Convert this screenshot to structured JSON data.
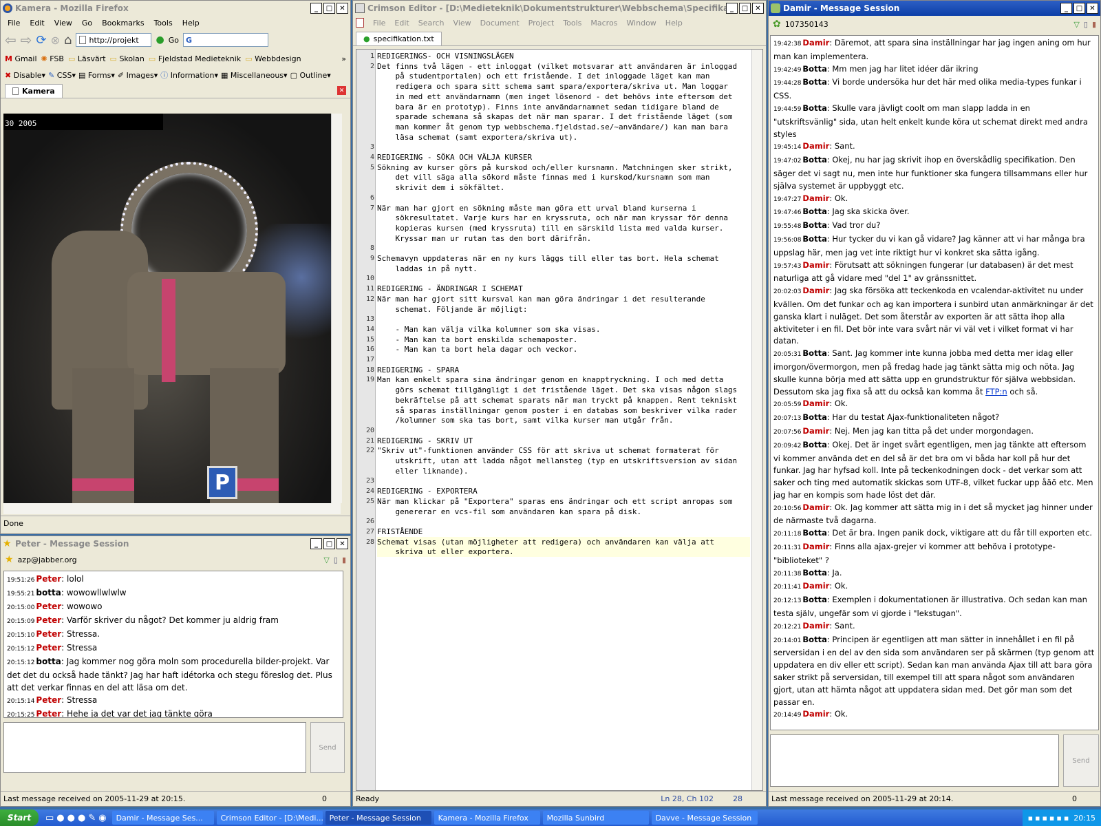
{
  "firefox": {
    "title": "Kamera - Mozilla Firefox",
    "menu": [
      "File",
      "Edit",
      "View",
      "Go",
      "Bookmarks",
      "Tools",
      "Help"
    ],
    "url": "http://projekt",
    "go_label": "Go",
    "bookmarks": [
      "Gmail",
      "FSB",
      "Läsvärt",
      "Skolan",
      "Fjeldstad Medieteknik",
      "Webbdesign"
    ],
    "webdev": [
      "Disable",
      "CSS",
      "Forms",
      "Images",
      "Information",
      "Miscellaneous",
      "Outline"
    ],
    "tab_label": "Kamera",
    "cam_timestamp": "30 2005",
    "status": "Done"
  },
  "peter": {
    "title": "Peter - Message Session",
    "contact": "azp@jabber.org",
    "messages": [
      {
        "ts": "19:51:26",
        "who": "Peter",
        "text": "lolol"
      },
      {
        "ts": "19:55:21",
        "who": "botta",
        "text": "wowowllwlwlw"
      },
      {
        "ts": "20:15:00",
        "who": "Peter",
        "text": "wowowo"
      },
      {
        "ts": "20:15:09",
        "who": "Peter",
        "text": "Varför skriver du något? Det kommer ju aldrig fram"
      },
      {
        "ts": "20:15:10",
        "who": "Peter",
        "text": "Stressa."
      },
      {
        "ts": "20:15:12",
        "who": "Peter",
        "text": "Stressa"
      },
      {
        "ts": "20:15:12",
        "who": "botta",
        "text": "Jag kommer nog göra moln som procedurella bilder-projekt. Var det det du också hade tänkt? Jag har haft idétorka och stegu föreslog det. Plus att det verkar finnas en del att läsa om det."
      },
      {
        "ts": "20:15:14",
        "who": "Peter",
        "text": "Stressa"
      },
      {
        "ts": "20:15:25",
        "who": "Peter",
        "text": "Hehe ja det var det jag tänkte göra"
      }
    ],
    "send_label": "Send",
    "status": "Last message received on 2005-11-29 at 20:15.",
    "count": "0"
  },
  "crimson": {
    "title": "Crimson Editor - [D:\\Medieteknik\\Dokumentstrukturer\\Webbschema\\Specifikation\\specifika...",
    "menu": [
      "File",
      "Edit",
      "Search",
      "View",
      "Document",
      "Project",
      "Tools",
      "Macros",
      "Window",
      "Help"
    ],
    "tab": "specifikation.txt",
    "rows": [
      {
        "n": "1",
        "t": "REDIGERINGS- OCH VISNINGSLÄGEN"
      },
      {
        "n": "2",
        "t": "Det finns två lägen - ett inloggat (vilket motsvarar att användaren är inloggad"
      },
      {
        "n": "",
        "t": "    på studentportalen) och ett fristående. I det inloggade läget kan man"
      },
      {
        "n": "",
        "t": "    redigera och spara sitt schema samt spara/exportera/skriva ut. Man loggar"
      },
      {
        "n": "",
        "t": "    in med ett användarnamn (men inget lösenord - det behövs inte eftersom det"
      },
      {
        "n": "",
        "t": "    bara är en prototyp). Finns inte användarnamnet sedan tidigare bland de"
      },
      {
        "n": "",
        "t": "    sparade schemana så skapas det när man sparar. I det fristående läget (som"
      },
      {
        "n": "",
        "t": "    man kommer åt genom typ webbschema.fjeldstad.se/~användare/) kan man bara"
      },
      {
        "n": "",
        "t": "    läsa schemat (samt exportera/skriva ut)."
      },
      {
        "n": "3",
        "t": ""
      },
      {
        "n": "4",
        "t": "REDIGERING - SÖKA OCH VÄLJA KURSER"
      },
      {
        "n": "5",
        "t": "Sökning av kurser görs på kurskod och/eller kursnamn. Matchningen sker strikt,"
      },
      {
        "n": "",
        "t": "    det vill säga alla sökord måste finnas med i kurskod/kursnamn som man"
      },
      {
        "n": "",
        "t": "    skrivit dem i sökfältet."
      },
      {
        "n": "6",
        "t": ""
      },
      {
        "n": "7",
        "t": "När man har gjort en sökning måste man göra ett urval bland kurserna i"
      },
      {
        "n": "",
        "t": "    sökresultatet. Varje kurs har en kryssruta, och när man kryssar för denna"
      },
      {
        "n": "",
        "t": "    kopieras kursen (med kryssruta) till en särskild lista med valda kurser."
      },
      {
        "n": "",
        "t": "    Kryssar man ur rutan tas den bort därifrån."
      },
      {
        "n": "8",
        "t": ""
      },
      {
        "n": "9",
        "t": "Schemavyn uppdateras när en ny kurs läggs till eller tas bort. Hela schemat"
      },
      {
        "n": "",
        "t": "    laddas in på nytt."
      },
      {
        "n": "10",
        "t": ""
      },
      {
        "n": "11",
        "t": "REDIGERING - ÄNDRINGAR I SCHEMAT"
      },
      {
        "n": "12",
        "t": "När man har gjort sitt kursval kan man göra ändringar i det resulterande"
      },
      {
        "n": "",
        "t": "    schemat. Följande är möjligt:"
      },
      {
        "n": "13",
        "t": ""
      },
      {
        "n": "14",
        "t": "    - Man kan välja vilka kolumner som ska visas."
      },
      {
        "n": "15",
        "t": "    - Man kan ta bort enskilda schemaposter."
      },
      {
        "n": "16",
        "t": "    - Man kan ta bort hela dagar och veckor."
      },
      {
        "n": "17",
        "t": ""
      },
      {
        "n": "18",
        "t": "REDIGERING - SPARA"
      },
      {
        "n": "19",
        "t": "Man kan enkelt spara sina ändringar genom en knapptryckning. I och med detta"
      },
      {
        "n": "",
        "t": "    görs schemat tillgängligt i det fristående läget. Det ska visas någon slags"
      },
      {
        "n": "",
        "t": "    bekräftelse på att schemat sparats när man tryckt på knappen. Rent tekniskt"
      },
      {
        "n": "",
        "t": "    så sparas inställningar genom poster i en databas som beskriver vilka rader"
      },
      {
        "n": "",
        "t": "    /kolumner som ska tas bort, samt vilka kurser man utgår från."
      },
      {
        "n": "20",
        "t": ""
      },
      {
        "n": "21",
        "t": "REDIGERING - SKRIV UT"
      },
      {
        "n": "22",
        "t": "\"Skriv ut\"-funktionen använder CSS för att skriva ut schemat formaterat för"
      },
      {
        "n": "",
        "t": "    utskrift, utan att ladda något mellansteg (typ en utskriftsversion av sidan"
      },
      {
        "n": "",
        "t": "    eller liknande)."
      },
      {
        "n": "23",
        "t": ""
      },
      {
        "n": "24",
        "t": "REDIGERING - EXPORTERA"
      },
      {
        "n": "25",
        "t": "När man klickar på \"Exportera\" sparas ens ändringar och ett script anropas som"
      },
      {
        "n": "",
        "t": "    genererar en vcs-fil som användaren kan spara på disk."
      },
      {
        "n": "26",
        "t": ""
      },
      {
        "n": "27",
        "t": "FRISTÅENDE"
      },
      {
        "n": "28",
        "t": "Schemat visas (utan möjligheter att redigera) och användaren kan välja att"
      },
      {
        "n": "",
        "t": "    skriva ut eller exportera."
      }
    ],
    "status_ready": "Ready",
    "status_pos": "Ln 28, Ch 102",
    "status_lines": "28"
  },
  "damir": {
    "title": "Damir - Message Session",
    "contact": "107350143",
    "messages_html_note": "",
    "messages": [
      {
        "ts": "19:42:38",
        "who": "Damir",
        "text": "Däremot, att spara sina inställningar har jag ingen aning om hur man kan implementera."
      },
      {
        "ts": "19:42:49",
        "who": "Botta",
        "text": "Mm men jag har litet idéer där ikring"
      },
      {
        "ts": "19:44:28",
        "who": "Botta",
        "text": "Vi borde undersöka hur det här med olika media-types funkar i CSS."
      },
      {
        "ts": "19:44:59",
        "who": "Botta",
        "text": "Skulle vara jävligt coolt om man slapp ladda in en \"utskriftsvänlig\" sida, utan helt enkelt kunde köra ut schemat direkt med andra styles"
      },
      {
        "ts": "19:45:14",
        "who": "Damir",
        "text": "Sant."
      },
      {
        "ts": "19:47:02",
        "who": "Botta",
        "text": "Okej, nu har jag skrivit ihop en överskådlig specifikation. Den säger det vi sagt nu, men inte hur funktioner ska fungera tillsammans eller hur själva systemet är uppbyggt etc."
      },
      {
        "ts": "19:47:27",
        "who": "Damir",
        "text": "Ok."
      },
      {
        "ts": "19:47:46",
        "who": "Botta",
        "text": "Jag ska skicka över."
      },
      {
        "ts": "19:55:48",
        "who": "Botta",
        "text": "Vad tror du?"
      },
      {
        "ts": "19:56:08",
        "who": "Botta",
        "text": "Hur tycker du vi kan gå vidare? Jag känner att vi har många bra uppslag här, men jag vet inte riktigt hur vi konkret ska sätta igång."
      },
      {
        "ts": "19:57:43",
        "who": "Damir",
        "text": "Förutsatt att sökningen fungerar (ur databasen) är det mest naturliga att gå vidare med \"del 1\" av gränssnittet."
      },
      {
        "ts": "20:02:03",
        "who": "Damir",
        "text": "Jag ska försöka att teckenkoda en vcalendar-aktivitet nu under kvällen. Om det funkar och ag kan importera i sunbird utan anmärkningar är det ganska klart i nuläget. Det som återstår av exporten är att sätta ihop alla aktiviteter i en fil. Det bör inte vara svårt när vi väl vet i vilket format vi har datan."
      },
      {
        "ts": "20:05:31",
        "who": "Botta",
        "text": "Sant. Jag kommer inte kunna jobba med detta mer idag eller imorgon/övermorgon, men på fredag hade jag tänkt sätta mig och nöta. Jag skulle kunna börja med att sätta upp en grundstruktur för själva webbsidan. Dessutom ska jag fixa så att du också kan komma åt",
        "link": "FTP:n",
        "after": " och så."
      },
      {
        "ts": "20:05:59",
        "who": "Damir",
        "text": "Ok."
      },
      {
        "ts": "20:07:13",
        "who": "Botta",
        "text": "Har du testat Ajax-funktionaliteten något?"
      },
      {
        "ts": "20:07:56",
        "who": "Damir",
        "text": "Nej. Men jag kan titta på det under morgondagen."
      },
      {
        "ts": "20:09:42",
        "who": "Botta",
        "text": "Okej. Det är inget svårt egentligen, men jag tänkte att eftersom vi kommer använda det en del så är det bra om vi båda har koll på hur det funkar. Jag har hyfsad koll. Inte på teckenkodningen dock - det verkar som att saker och ting med automatik skickas som UTF-8, vilket fuckar upp åäö etc. Men jag har en kompis som hade löst det där."
      },
      {
        "ts": "20:10:56",
        "who": "Damir",
        "text": "Ok. Jag kommer att sätta mig in i det så mycket jag hinner under de närmaste två dagarna."
      },
      {
        "ts": "20:11:18",
        "who": "Botta",
        "text": "Det är bra. Ingen panik dock, viktigare att du får till exporten etc."
      },
      {
        "ts": "20:11:31",
        "who": "Damir",
        "text": "Finns alla ajax-grejer vi kommer att behöva i prototype-\"biblioteket\" ?"
      },
      {
        "ts": "20:11:38",
        "who": "Botta",
        "text": "Ja."
      },
      {
        "ts": "20:11:41",
        "who": "Damir",
        "text": "Ok."
      },
      {
        "ts": "20:12:13",
        "who": "Botta",
        "text": "Exemplen i dokumentationen är illustrativa. Och sedan kan man testa själv, ungefär som vi gjorde i \"lekstugan\"."
      },
      {
        "ts": "20:12:21",
        "who": "Damir",
        "text": "Sant."
      },
      {
        "ts": "20:14:01",
        "who": "Botta",
        "text": "Principen är egentligen att man sätter in innehållet i en fil på serversidan i en del av den sida som användaren ser på skärmen (typ genom att uppdatera en div eller ett script). Sedan kan man använda Ajax till att bara göra saker strikt på serversidan, till exempel till att spara något som användaren gjort, utan att hämta något att uppdatera sidan med. Det gör man som det passar en."
      },
      {
        "ts": "20:14:49",
        "who": "Damir",
        "text": "Ok."
      }
    ],
    "send_label": "Send",
    "status": "Last message received on 2005-11-29 at 20:14.",
    "count": "0"
  },
  "taskbar": {
    "start": "Start",
    "tasks": [
      "Damir - Message Ses...",
      "Crimson Editor - [D:\\Medi...",
      "Peter - Message Session",
      "Kamera - Mozilla Firefox",
      "Mozilla Sunbird",
      "Davve - Message Session"
    ],
    "active_index": 2,
    "clock": "20:15"
  },
  "colors": {
    "damir_name": "#c00000",
    "peter_name": "#c00000",
    "titlebar": "#0c3fa8",
    "taskbar": "#235bd0"
  }
}
